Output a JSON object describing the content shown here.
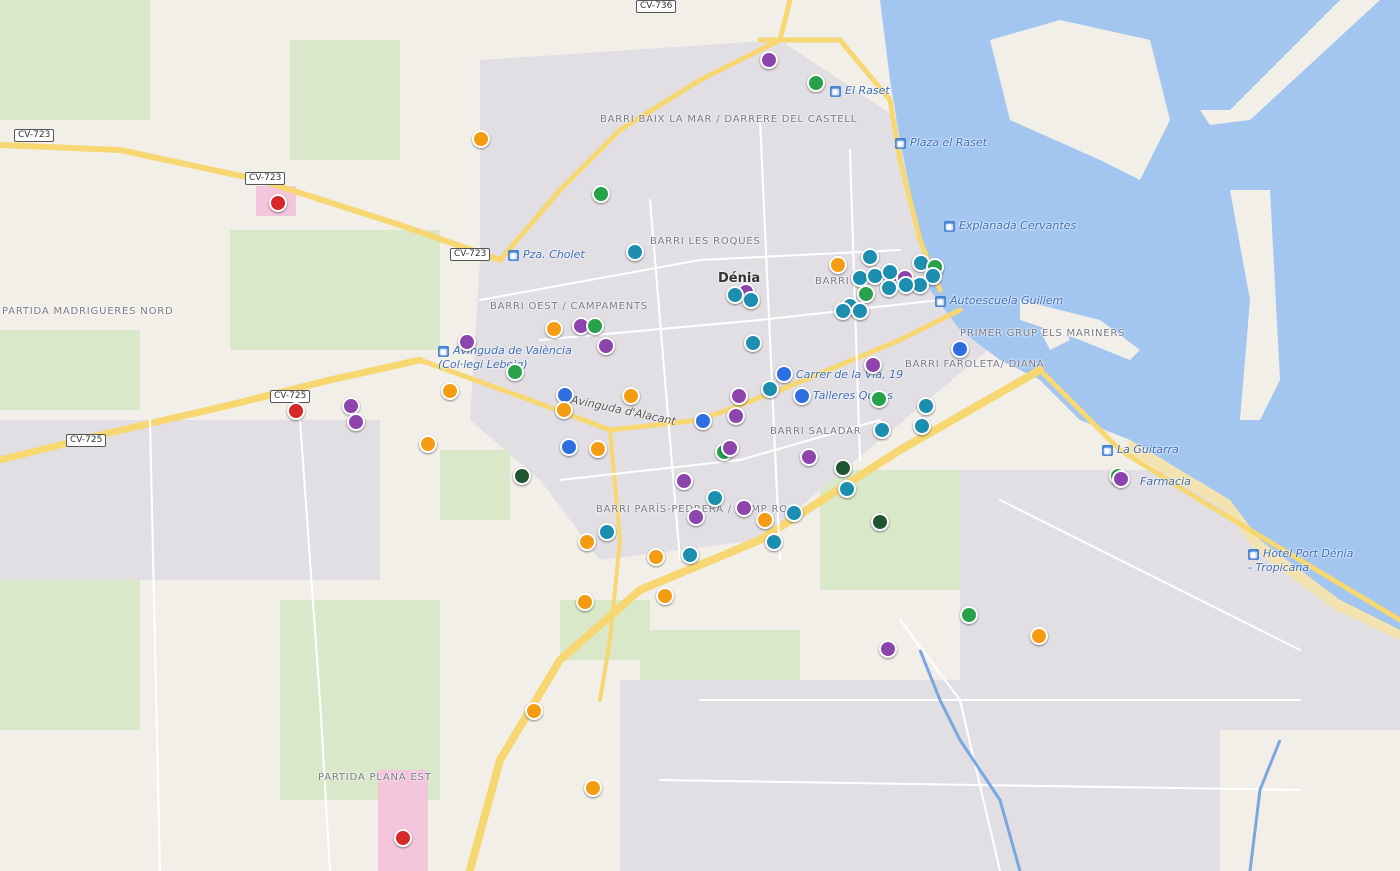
{
  "map": {
    "town": "Dénia",
    "district_labels": [
      "BARRI BAIX LA MAR / DARRERE DEL CASTELL",
      "BARRI LES ROQUES",
      "BARRI OEST / CAMPAMENTS",
      "PARTIDA MADRIGUERES NORD",
      "PRIMER GRUP ELS MARINERS",
      "BARRI FAROLETA/ DIANA",
      "BARRI SALADAR",
      "BARRI PARÍS-PEDRERA / CAMP ROIG",
      "PARTIDA PLANA EST",
      "BARRI CENTRE"
    ],
    "road_shields": [
      "CV-723",
      "CV-723",
      "CV-723",
      "CV-725",
      "CV-725",
      "CV-736"
    ],
    "pois": [
      "El Raset",
      "Plaza el Raset",
      "Explanada Cervantes",
      "Pza. Cholet",
      "Autoescuela Guillem",
      "Avinguda de València (Col·legi Lebeig)",
      "Carrer de la Via, 19",
      "Talleres Quiles",
      "La Guitarra",
      "Farmacia",
      "Hotel Port Dénia - Tropicana",
      "Avinguda d'Alacant"
    ],
    "colors": {
      "orange": "#f39c12",
      "purple": "#8e44ad",
      "teal": "#1c8fb0",
      "green": "#27a24a",
      "dark_green": "#1e5631",
      "blue": "#2d6fe0",
      "red": "#d62828",
      "water": "#a3c6f0",
      "land": "#f2efe9",
      "park": "#d5e8c4"
    }
  }
}
